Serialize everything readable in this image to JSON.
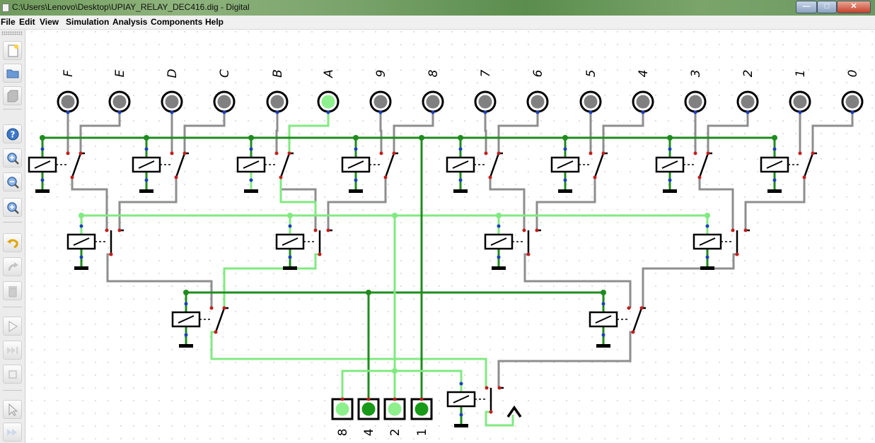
{
  "window": {
    "title": "C:\\Users\\Lenovo\\Desktop\\UPIAY_RELAY_DEC416.dig - Digital"
  },
  "menu": [
    "File",
    "Edit",
    "View",
    "Simulation",
    "Analysis",
    "Components",
    "Help"
  ],
  "toolbar": [
    "new-file",
    "open-folder",
    "save-disk",
    "help",
    "zoom-in",
    "zoom-out",
    "zoom-fit",
    "undo",
    "redo",
    "delete",
    "run",
    "step",
    "stop",
    "select",
    "fast-forward"
  ],
  "colors": {
    "wire_low": "#8e8e8e",
    "wire_bus": "#1e8c1e",
    "wire_high": "#80ea80",
    "output_on": "#8df08d"
  },
  "outputs": [
    {
      "label": "F",
      "on": false
    },
    {
      "label": "E",
      "on": false
    },
    {
      "label": "D",
      "on": false
    },
    {
      "label": "C",
      "on": false
    },
    {
      "label": "B",
      "on": false
    },
    {
      "label": "A",
      "on": true
    },
    {
      "label": "9",
      "on": false
    },
    {
      "label": "8",
      "on": false
    },
    {
      "label": "7",
      "on": false
    },
    {
      "label": "6",
      "on": false
    },
    {
      "label": "5",
      "on": false
    },
    {
      "label": "4",
      "on": false
    },
    {
      "label": "3",
      "on": false
    },
    {
      "label": "2",
      "on": false
    },
    {
      "label": "1",
      "on": false
    },
    {
      "label": "0",
      "on": false
    }
  ],
  "inputs": [
    {
      "label": "8",
      "on": true,
      "shade": "light"
    },
    {
      "label": "4",
      "on": true,
      "shade": "dark"
    },
    {
      "label": "2",
      "on": true,
      "shade": "light"
    },
    {
      "label": "1",
      "on": true,
      "shade": "dark"
    }
  ]
}
